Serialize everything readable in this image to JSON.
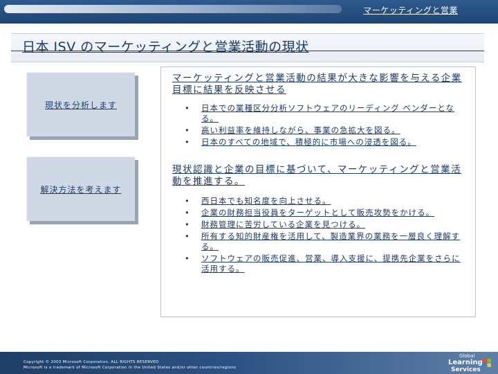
{
  "header": {
    "section_label": "マーケッティングと営業"
  },
  "page": {
    "title": "日本 ISV のマーケッティングと営業活動の現状"
  },
  "nav": {
    "analyze_label": "現状を分析します",
    "solve_label": "解決方法を考えます"
  },
  "content": {
    "heading1": "マーケッティングと営業活動の結果が大きな影響を与える企業目標に結果を反映させる",
    "bullets1": [
      "日本での業種区分分析ソフトウェアのリーディング ベンダーとなる。",
      "高い利益率を維持しながら、事業の急拡大を図る。",
      "日本のすべての地域で、積極的に市場への浸透を図る。"
    ],
    "heading2": "現状認識と企業の目標に基づいて、マーケッティングと営業活動を推進する。",
    "bullets2": [
      "西日本でも知名度を向上させる。",
      "企業の財務担当役員をターゲットとして販売攻勢をかける。",
      "財務管理に苦労している企業を見つける。",
      "所有する知的財産権を活用して、製造業界の業務を一層良く理解する。",
      "ソフトウェアの販売促進、営業、導入支援に、提携先企業をさらに活用する。"
    ],
    "bullet_glyph": "•"
  },
  "footer": {
    "copyright": "Copyright © 2003 Microsoft Corporation. ALL RIGHTS RESERVED",
    "trademark": "Microsoft is a trademark of Microsoft Corporation in the United States and/or other countries/regions"
  },
  "logo": {
    "line1": "Global",
    "line2": "Learning",
    "line3": "Services"
  },
  "colors": {
    "brand": "#1e4676",
    "text": "#1c3a66",
    "nav_box": "#cfd9e6"
  }
}
